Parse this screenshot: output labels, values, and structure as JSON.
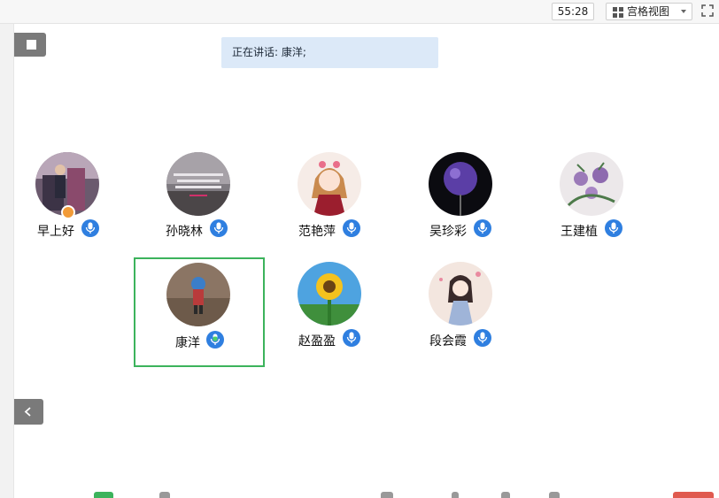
{
  "toolbar": {
    "timer": "55:28",
    "view_mode": "宫格视图"
  },
  "status": {
    "speaking": "正在讲话: 康洋;"
  },
  "participants": [
    {
      "name": "早上好",
      "mic": "on",
      "host": true
    },
    {
      "name": "孙晓林",
      "mic": "on"
    },
    {
      "name": "范艳萍",
      "mic": "on"
    },
    {
      "name": "吴珍彩",
      "mic": "on"
    },
    {
      "name": "王建植",
      "mic": "on"
    },
    {
      "name": "康洋",
      "mic": "speaking",
      "active": true
    },
    {
      "name": "赵盈盈",
      "mic": "on"
    },
    {
      "name": "段会霞",
      "mic": "on"
    }
  ],
  "colors": {
    "mic_blue": "#2f7fe0",
    "active_border": "#3cb35c",
    "speaking_bg": "#dce9f8",
    "host_badge": "#f29b38"
  },
  "icons": {
    "stop": "stop-icon",
    "back": "chevron-left-icon",
    "view": "grid-icon",
    "fullscreen": "fullscreen-icon",
    "mic": "microphone-icon"
  }
}
